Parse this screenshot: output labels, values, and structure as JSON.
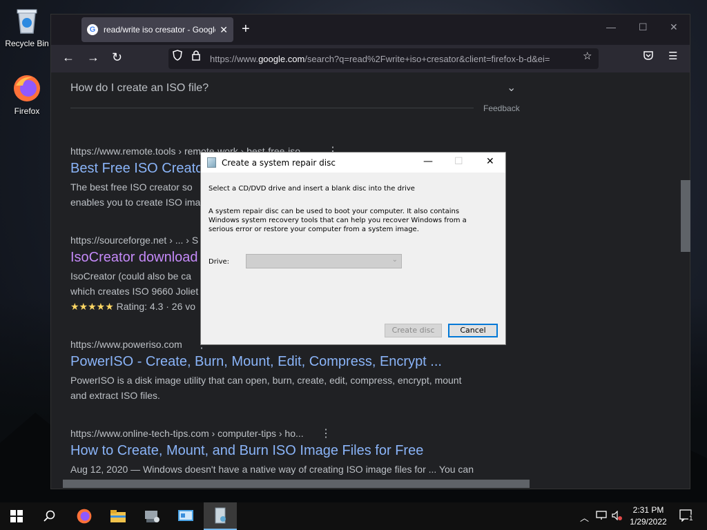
{
  "desktop": {
    "icons": [
      {
        "label": "Recycle Bin"
      },
      {
        "label": "Firefox"
      }
    ]
  },
  "browser": {
    "tab_title": "read/write iso cresator - Google",
    "url_prefix": "https://www.",
    "url_domain": "google.com",
    "url_rest": "/search?q=read%2Fwrite+iso+cresator&client=firefox-b-d&ei="
  },
  "page": {
    "faq_question": "How do I create an ISO file?",
    "feedback": "Feedback",
    "results": [
      {
        "url": "https://www.remote.tools › remote-work › best-free-iso...",
        "title": "Best Free ISO Creator",
        "snippet_1": "The best free ISO creator so",
        "snippet_2": "enables you to create ISO ima"
      },
      {
        "url": "https://sourceforge.net › ... › S",
        "title": "IsoCreator download",
        "snippet_1": "IsoCreator (could also be ca",
        "snippet_2": "which creates ISO 9660 Joliet",
        "rating": "Rating: 4.3 · 26 vo"
      },
      {
        "url": "https://www.poweriso.com",
        "title": "PowerISO - Create, Burn, Mount, Edit, Compress, Encrypt ...",
        "snippet_1": "PowerISO is a disk image utility that can open, burn, create, edit, compress, encrypt, mount",
        "snippet_2": "and extract ISO files."
      },
      {
        "url": "https://www.online-tech-tips.com › computer-tips › ho...",
        "title": "How to Create, Mount, and Burn ISO Image Files for Free",
        "snippet_1": "Aug 12, 2020 — Windows doesn't have a native way of creating ISO image files for ... You can"
      }
    ]
  },
  "dialog": {
    "title": "Create a system repair disc",
    "instruction": "Select a CD/DVD drive and insert a blank disc into the drive",
    "description": "A system repair disc can be used to boot your computer. It also contains Windows system recovery tools that can help you recover Windows from a serious error or restore your computer from a system image.",
    "drive_label": "Drive:",
    "drive_value": "",
    "create_button": "Create disc",
    "cancel_button": "Cancel"
  },
  "taskbar": {
    "time": "2:31 PM",
    "date": "1/29/2022",
    "notification_count": "1"
  }
}
